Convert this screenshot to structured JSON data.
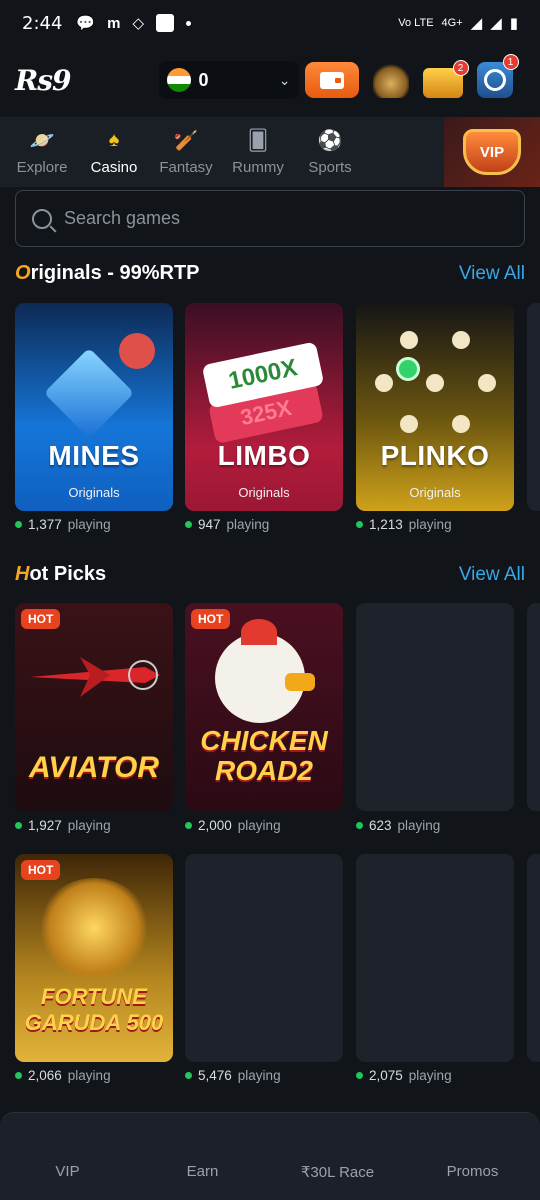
{
  "status_bar": {
    "time": "2:44",
    "network": "4G+",
    "volte": "Vo LTE"
  },
  "header": {
    "logo": "Rs9",
    "balance": "0",
    "notif_chest": "2",
    "notif_support": "1"
  },
  "categories": [
    {
      "label": "Explore",
      "icon": "planet-icon",
      "active": false
    },
    {
      "label": "Casino",
      "icon": "spade-icon",
      "active": true
    },
    {
      "label": "Fantasy",
      "icon": "cricket-icon",
      "active": false
    },
    {
      "label": "Rummy",
      "icon": "cards-icon",
      "active": false
    },
    {
      "label": "Sports",
      "icon": "football-icon",
      "active": false
    }
  ],
  "vip_badge": "VIP",
  "search": {
    "placeholder": "Search games"
  },
  "originals": {
    "title_first": "O",
    "title_rest": "riginals - 99%RTP",
    "view_all": "View All",
    "games": [
      {
        "name": "MINES",
        "sub": "Originals",
        "playing": "1,377",
        "suffix": "playing"
      },
      {
        "name": "LIMBO",
        "sub": "Originals",
        "playing": "947",
        "suffix": "playing",
        "tag1": "1000X",
        "tag2": "325X"
      },
      {
        "name": "PLINKO",
        "sub": "Originals",
        "playing": "1,213",
        "suffix": "playing"
      }
    ]
  },
  "hot_picks": {
    "title_first": "H",
    "title_rest": "ot Picks",
    "view_all": "View All",
    "hot_label": "HOT",
    "row1": [
      {
        "name": "AVIATOR",
        "playing": "1,927",
        "suffix": "playing"
      },
      {
        "name_l1": "CHICKEN",
        "name_l2": "ROAD2",
        "playing": "2,000",
        "suffix": "playing"
      },
      {
        "playing": "623",
        "suffix": "playing"
      }
    ],
    "row2": [
      {
        "name_l1": "FORTUNE",
        "name_l2": "GARUDA 500",
        "playing": "2,066",
        "suffix": "playing"
      },
      {
        "playing": "5,476",
        "suffix": "playing"
      },
      {
        "playing": "2,075",
        "suffix": "playing"
      }
    ]
  },
  "bottom_nav": [
    "VIP",
    "Earn",
    "₹30L Race",
    "Promos"
  ],
  "colors": {
    "accent_blue": "#38a8e8",
    "accent_orange": "#f5a623",
    "online_green": "#22c55e",
    "hot_red": "#e8431f"
  }
}
